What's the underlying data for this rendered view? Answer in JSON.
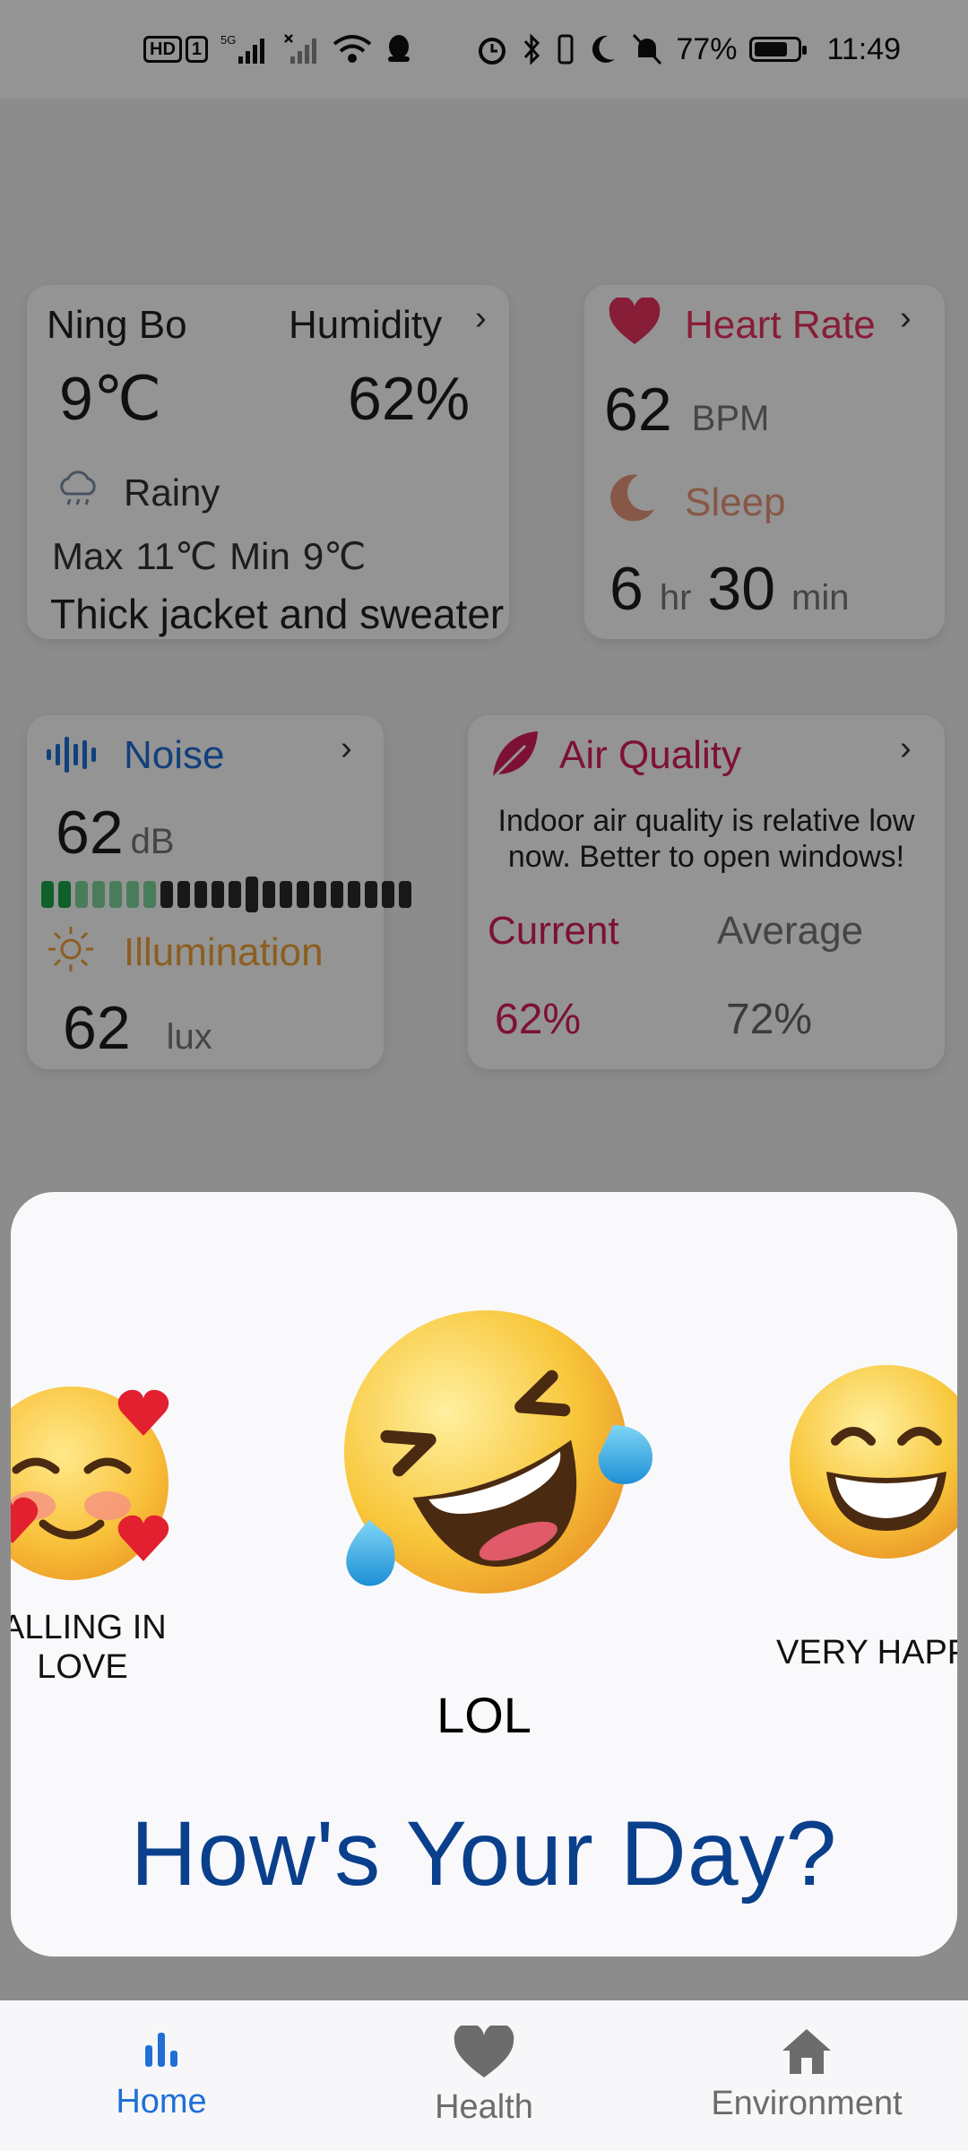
{
  "status_bar": {
    "hd_label": "HD",
    "sim_label": "1",
    "network_label": "5G",
    "battery_text": "77%",
    "battery_level": 0.77,
    "time": "11:49"
  },
  "weather_card": {
    "city": "Ning Bo",
    "humidity_label": "Humidity",
    "temperature": "9℃",
    "humidity_value": "62%",
    "condition": "Rainy",
    "max_label": "Max",
    "max_value": "11℃",
    "min_label": "Min",
    "min_value": "9℃",
    "advice": "Thick jacket and sweater",
    "icon": "cloud-rain-icon"
  },
  "heart_card": {
    "title": "Heart Rate",
    "value": "62",
    "unit": "BPM",
    "sleep_label": "Sleep",
    "sleep_hours": "6",
    "hours_unit": "hr",
    "sleep_minutes": "30",
    "minutes_unit": "min",
    "accent_color": "#e8335f",
    "sleep_color": "#e9967a"
  },
  "noise_card": {
    "title": "Noise",
    "value": "62",
    "unit": "dB",
    "illumination_label": "Illumination",
    "illumination_value": "62",
    "illumination_unit": "lux",
    "accent_color": "#1f6fd6",
    "illumination_color": "#f2a33a"
  },
  "air_card": {
    "title": "Air Quality",
    "message": "Indoor air quality is relative low now. Better to open windows!",
    "current_label": "Current",
    "average_label": "Average",
    "current_value": "62%",
    "average_value": "72%",
    "accent_color": "#d81e5b"
  },
  "mood_sheet": {
    "left_label": "ALLING IN LOVE",
    "left_label_line1": "ALLING IN",
    "left_label_line2": "LOVE",
    "center_label": "LOL",
    "right_label": "VERY HAPP",
    "title": "How's Your Day?",
    "title_color": "#0a3f8c"
  },
  "bottom_nav": {
    "items": [
      {
        "label": "Home",
        "icon": "bar-chart-icon",
        "active": true
      },
      {
        "label": "Health",
        "icon": "heart-icon",
        "active": false
      },
      {
        "label": "Environment",
        "icon": "house-icon",
        "active": false
      }
    ],
    "active_color": "#1f6fd6"
  }
}
